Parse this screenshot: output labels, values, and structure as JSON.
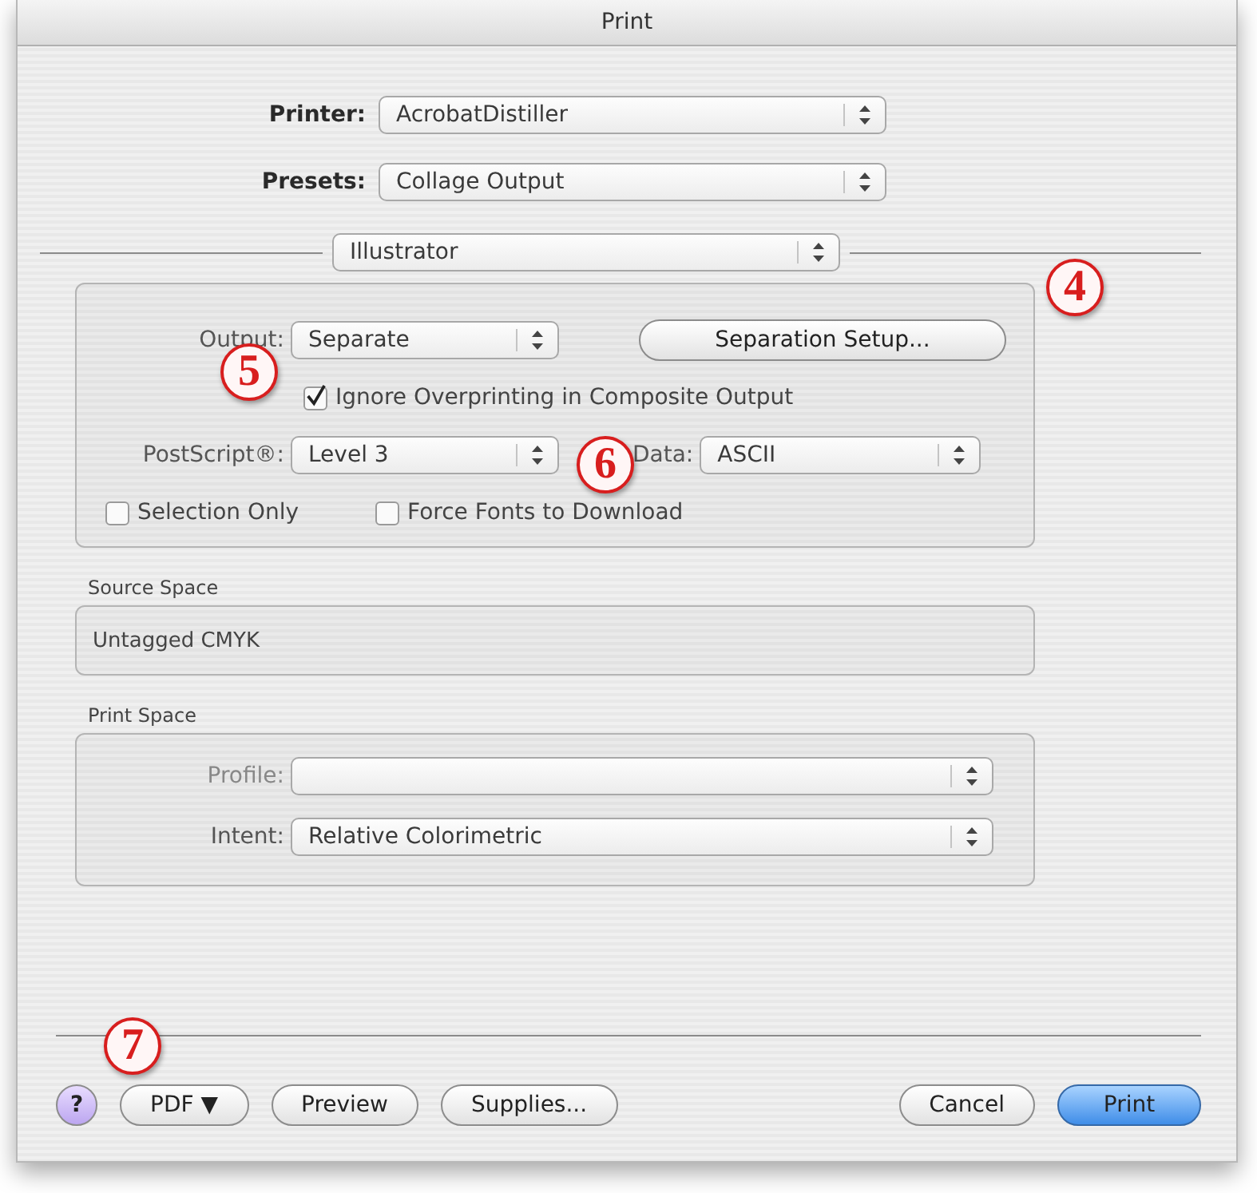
{
  "window": {
    "title": "Print"
  },
  "printer": {
    "label": "Printer:",
    "value": "AcrobatDistiller"
  },
  "presets": {
    "label": "Presets:",
    "value": "Collage Output"
  },
  "pane": {
    "value": "Illustrator"
  },
  "options": {
    "output": {
      "label": "Output:",
      "value": "Separate"
    },
    "separation_button": "Separation Setup...",
    "ignore_overprinting": {
      "label": "Ignore Overprinting in Composite Output",
      "checked": true
    },
    "postscript": {
      "label": "PostScript®:",
      "value": "Level 3"
    },
    "data": {
      "label": "Data:",
      "value": "ASCII"
    },
    "selection_only": {
      "label": "Selection Only",
      "checked": false
    },
    "force_fonts": {
      "label": "Force Fonts to Download",
      "checked": false
    }
  },
  "source_space": {
    "title": "Source Space",
    "value": "Untagged CMYK"
  },
  "print_space": {
    "title": "Print Space",
    "profile": {
      "label": "Profile:"
    },
    "intent": {
      "label": "Intent:",
      "value": "Relative Colorimetric"
    }
  },
  "buttons": [
    {
      "label": "?",
      "kind": "help"
    },
    {
      "label": "PDF ▼",
      "kind": "plain"
    },
    {
      "label": "Preview",
      "kind": "plain"
    },
    {
      "label": "Supplies...",
      "kind": "plain"
    },
    {
      "label": "Cancel",
      "kind": "plain"
    },
    {
      "label": "Print",
      "kind": "default"
    }
  ],
  "callouts": [
    {
      "number": "4"
    },
    {
      "number": "5"
    },
    {
      "number": "6"
    },
    {
      "number": "7"
    }
  ]
}
